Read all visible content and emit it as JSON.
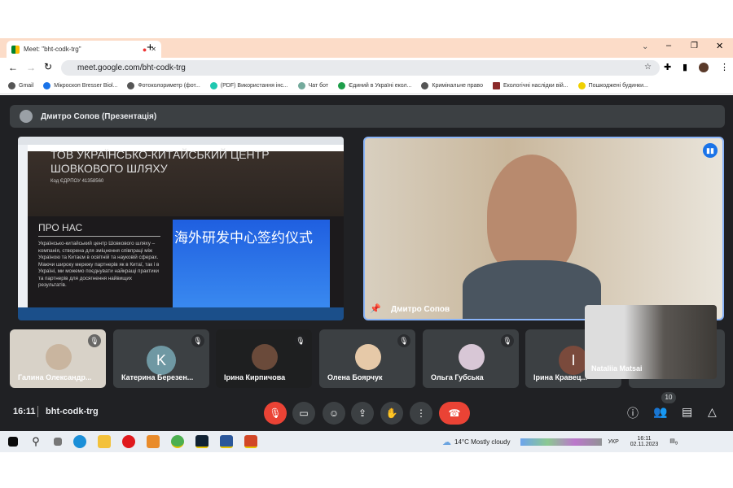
{
  "browser": {
    "tab_title": "Meet: \"bht-codk-trg\"",
    "url": "meet.google.com/bht-codk-trg",
    "bookmarks": [
      "Gmail",
      "Мікроскоп Bresser Biol...",
      "Фотоколориметр (фот...",
      "(PDF) Використання інс...",
      "Чат бот",
      "Єдиний в Україні екол...",
      "Кримінальне право",
      "Екологічні наслідки вій...",
      "Пошкоджені будинки..."
    ]
  },
  "meet": {
    "presenter_banner": "Дмитро Сопов (Презентація)",
    "presentation": {
      "heading": "ТОВ УКРАЇНСЬКО-КИТАЙСЬКИЙ ЦЕНТР ШОВКОВОГО ШЛЯХУ",
      "code": "Код ЄДРПОУ 41358560",
      "section": "ПРО НАС",
      "body": "Українсько-китайський центр Шовкового шляху – компанія, створена для зміцнення співпраці між Україною та Китаєм в освітній та науковій сферах. Маючи широку мережу партнерів як в Китаї, так і в Україні, ми можемо поєднувати найкращі практики та партнерів для досягнення найвищих результатів.",
      "banner_text": "海外研发中心签约仪式"
    },
    "speaker_name": "Дмитро Сопов",
    "participants": [
      {
        "name": "Галина Олександр..."
      },
      {
        "name": "Катерина Березен...",
        "initial": "K",
        "color": "#6f98a3"
      },
      {
        "name": "Ірина Кирпичова"
      },
      {
        "name": "Олена Боярчук"
      },
      {
        "name": "Ольга Губська"
      },
      {
        "name": "Ірина Кравец...",
        "initial": "I",
        "color": "#7a4a3c"
      }
    ],
    "floating_name": "Nataliia Matsai",
    "time": "16:11",
    "meeting_code": "bht-codk-trg",
    "participant_count": "10"
  },
  "taskbar": {
    "weather": "14°C  Mostly cloudy",
    "lang": "УКР",
    "time": "16:11",
    "date": "02.11.2023",
    "notif": "9"
  }
}
